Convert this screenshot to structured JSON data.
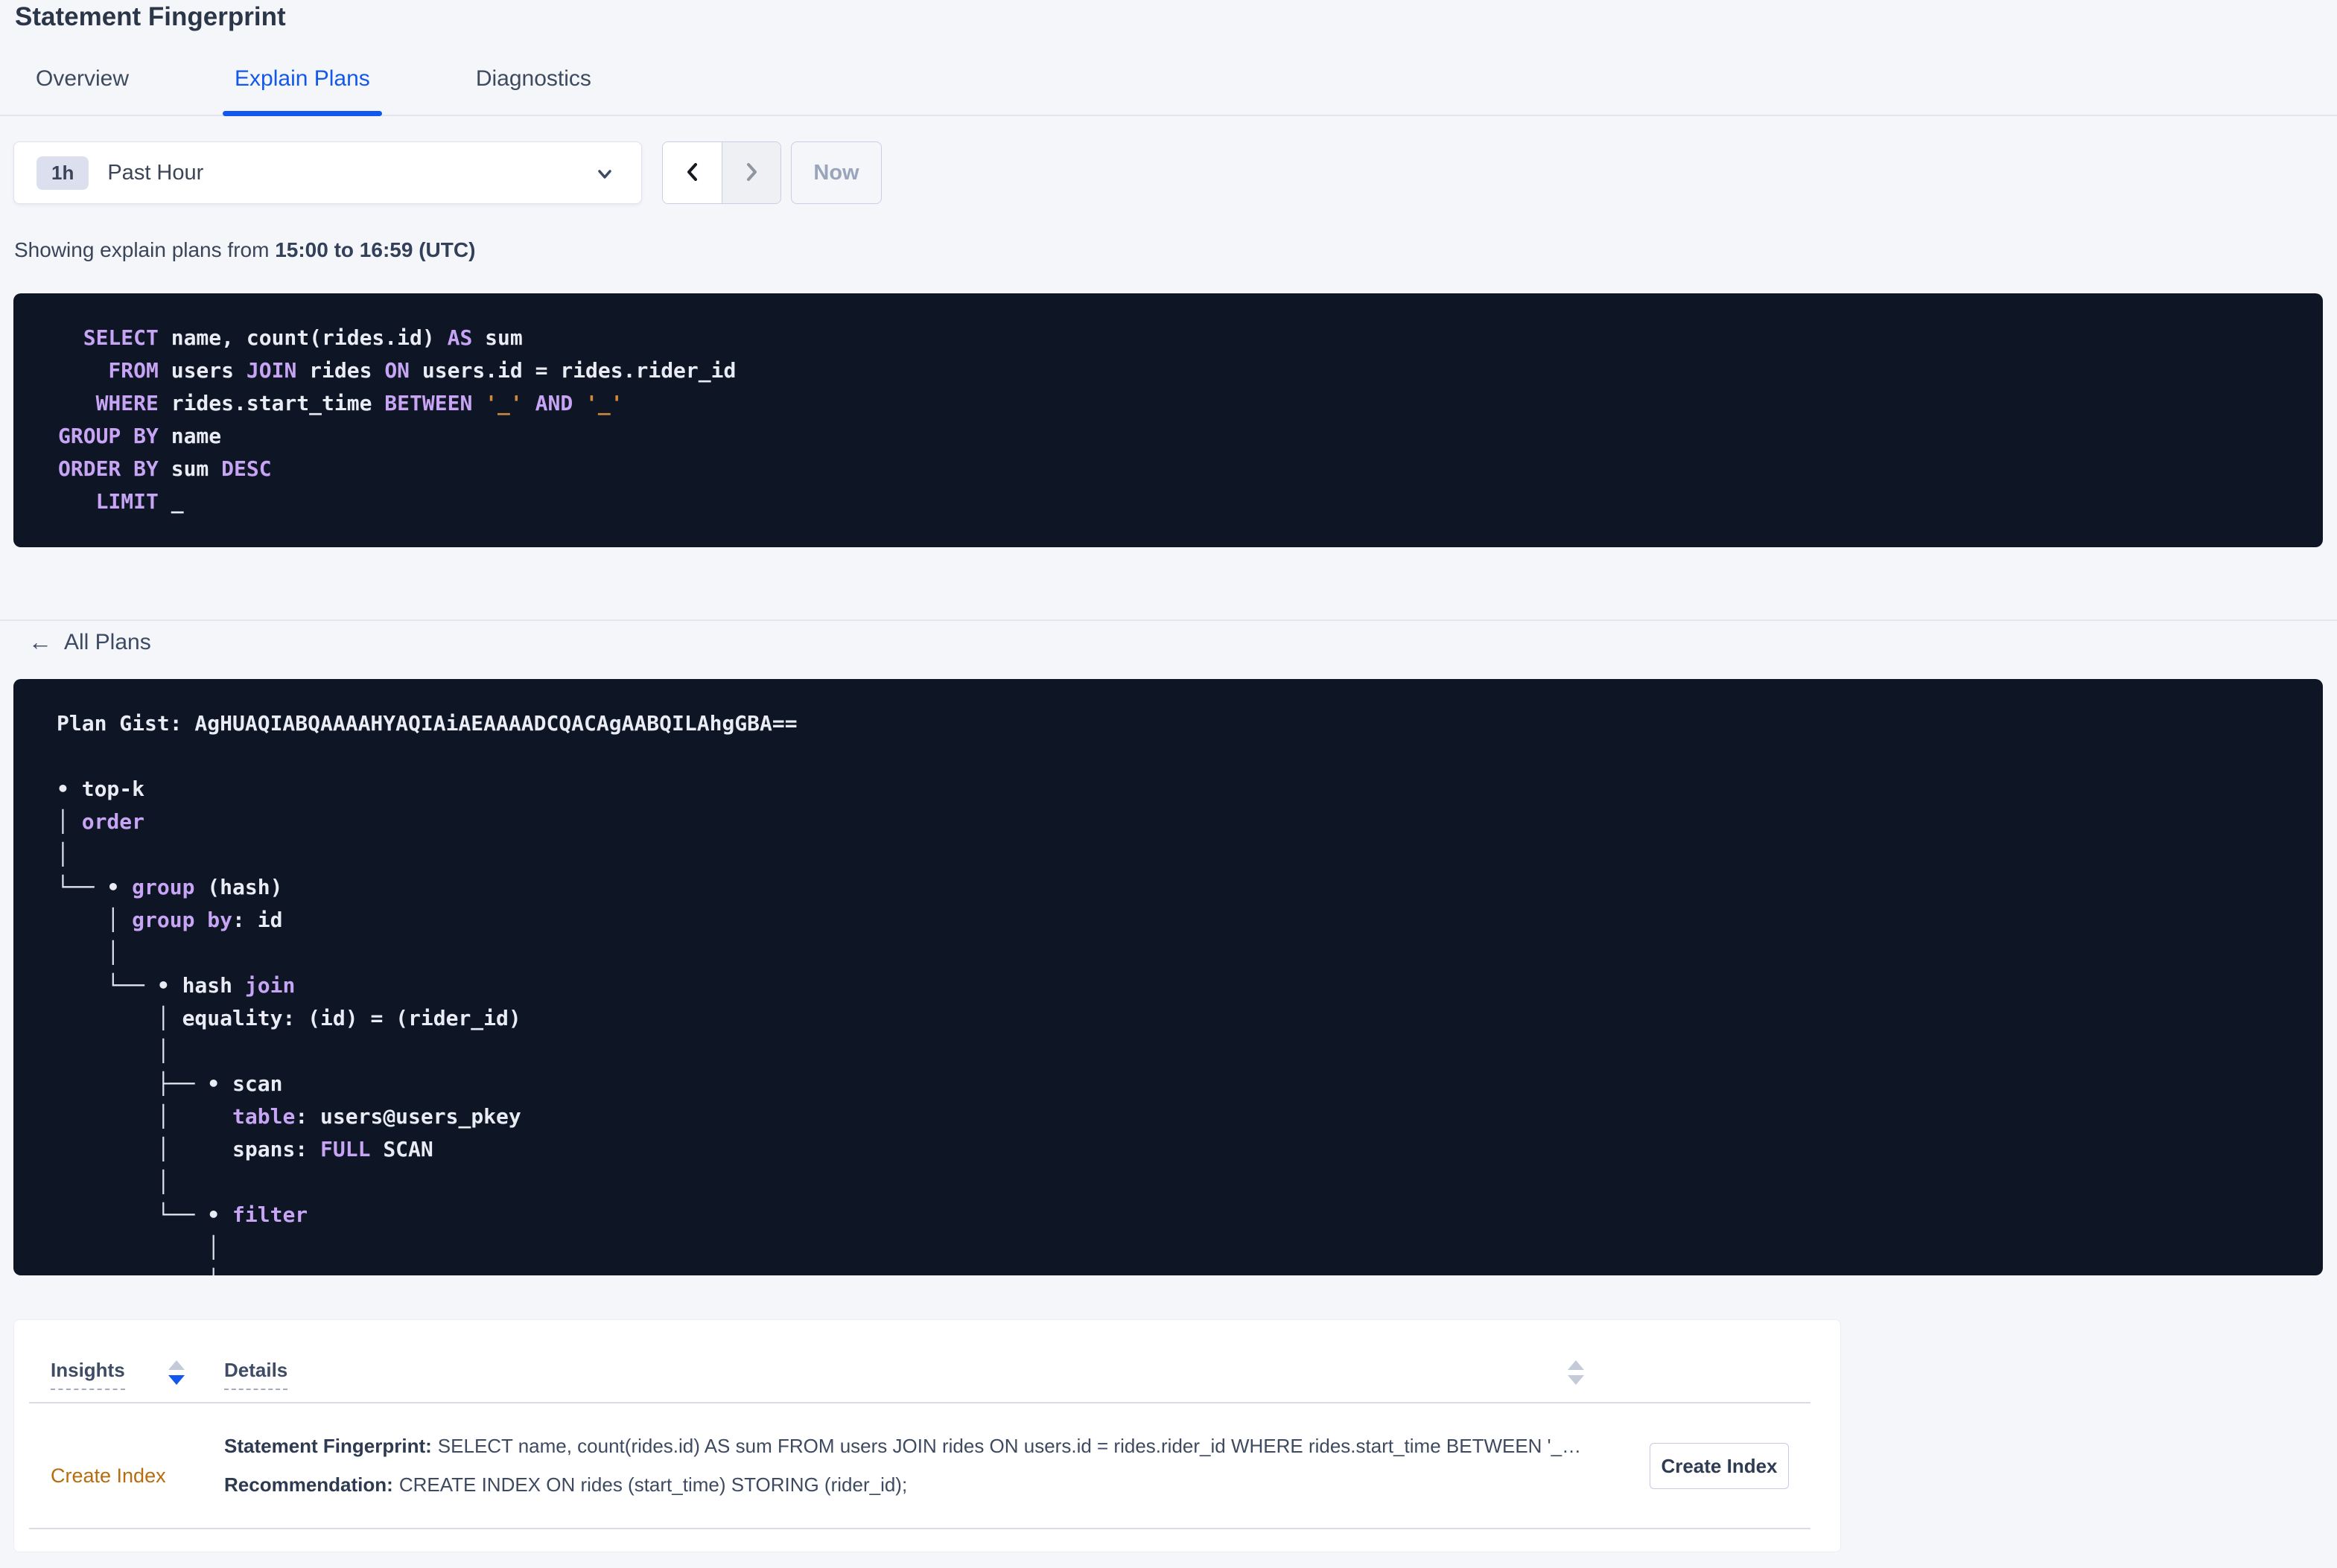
{
  "page": {
    "title": "Statement Fingerprint"
  },
  "tabs": {
    "overview": "Overview",
    "explain_plans": "Explain Plans",
    "diagnostics": "Diagnostics",
    "active_tab": "Explain Plans"
  },
  "time_picker": {
    "badge": "1h",
    "selected": "Past Hour",
    "now_label": "Now",
    "prev_enabled": true,
    "next_enabled": false
  },
  "status": {
    "prefix": "Showing explain plans from ",
    "range": "15:00 to 16:59 (UTC)"
  },
  "sql": {
    "lines": [
      [
        [
          "kw",
          "  SELECT"
        ],
        [
          "tx",
          " name, count(rides.id) "
        ],
        [
          "kw",
          "AS"
        ],
        [
          "tx",
          " sum"
        ]
      ],
      [
        [
          "kw",
          "    FROM"
        ],
        [
          "tx",
          " users "
        ],
        [
          "kw",
          "JOIN"
        ],
        [
          "tx",
          " rides "
        ],
        [
          "kw",
          "ON"
        ],
        [
          "tx",
          " users.id = rides.rider_id"
        ]
      ],
      [
        [
          "kw",
          "   WHERE"
        ],
        [
          "tx",
          " rides.start_time "
        ],
        [
          "kw",
          "BETWEEN"
        ],
        [
          "tx",
          " "
        ],
        [
          "st",
          "'_'"
        ],
        [
          "tx",
          " "
        ],
        [
          "kw",
          "AND"
        ],
        [
          "tx",
          " "
        ],
        [
          "st",
          "'_'"
        ]
      ],
      [
        [
          "kw",
          "GROUP BY"
        ],
        [
          "tx",
          " name"
        ]
      ],
      [
        [
          "kw",
          "ORDER BY"
        ],
        [
          "tx",
          " sum "
        ],
        [
          "kw",
          "DESC"
        ]
      ],
      [
        [
          "kw",
          "   LIMIT"
        ],
        [
          "tx",
          " _"
        ]
      ]
    ]
  },
  "back_link": {
    "label": "All Plans"
  },
  "plan": {
    "gist": "AgHUAQIABQAAAAHYAQIAiAEAAAADCQACAgAABQILAhgGBA==",
    "lines": [
      [
        [
          "tx",
          "Plan Gist: AgHUAQIABQAAAAHYAQIAiAEAAAADCQACAgAABQILAhgGBA=="
        ]
      ],
      [],
      [
        [
          "tx",
          "• top-k"
        ]
      ],
      [
        [
          "ln",
          "│ "
        ],
        [
          "kw",
          "order"
        ]
      ],
      [
        [
          "ln",
          "│"
        ]
      ],
      [
        [
          "ln",
          "└── "
        ],
        [
          "tx",
          "• "
        ],
        [
          "kw",
          "group"
        ],
        [
          "tx",
          " (hash)"
        ]
      ],
      [
        [
          "ln",
          "    │ "
        ],
        [
          "kw",
          "group by"
        ],
        [
          "tx",
          ": id"
        ]
      ],
      [
        [
          "ln",
          "    │"
        ]
      ],
      [
        [
          "ln",
          "    └── "
        ],
        [
          "tx",
          "• hash "
        ],
        [
          "kw",
          "join"
        ]
      ],
      [
        [
          "ln",
          "        │ "
        ],
        [
          "tx",
          "equality: (id) = (rider_id)"
        ]
      ],
      [
        [
          "ln",
          "        │"
        ]
      ],
      [
        [
          "ln",
          "        ├── "
        ],
        [
          "tx",
          "• scan"
        ]
      ],
      [
        [
          "ln",
          "        │     "
        ],
        [
          "kw",
          "table"
        ],
        [
          "tx",
          ": users@users_pkey"
        ]
      ],
      [
        [
          "ln",
          "        │     "
        ],
        [
          "tx",
          "spans: "
        ],
        [
          "kw",
          "FULL"
        ],
        [
          "tx",
          " SCAN"
        ]
      ],
      [
        [
          "ln",
          "        │"
        ]
      ],
      [
        [
          "ln",
          "        └── "
        ],
        [
          "tx",
          "• "
        ],
        [
          "kw",
          "filter"
        ]
      ],
      [
        [
          "ln",
          "            │"
        ]
      ],
      [
        [
          "ln",
          "            │"
        ]
      ]
    ]
  },
  "insights_table": {
    "columns": [
      "Insights",
      "Details"
    ],
    "sort": {
      "column": "Insights",
      "direction": "desc"
    },
    "rows": [
      {
        "insight": "Create Index",
        "fingerprint_label": "Statement Fingerprint:",
        "fingerprint": "SELECT name, count(rides.id) AS sum FROM users JOIN rides ON users.id = rides.rider_id WHERE rides.start_time BETWEEN '_…",
        "recommendation_label": "Recommendation:",
        "recommendation": "CREATE INDEX ON rides (start_time) STORING (rider_id);",
        "action": "Create Index"
      }
    ]
  },
  "icons": [
    "chevron-down-icon",
    "chevron-left-icon",
    "chevron-right-icon",
    "back-arrow-icon",
    "sort-icon"
  ],
  "colors": {
    "accent_blue": "#1258ee",
    "insight_orange": "#b76c0e",
    "code_background": "#0e1626",
    "code_keyword": "#c7a5f4",
    "code_text": "#e9ecf4",
    "code_literal": "#d0883c",
    "page_background": "#f4f6fa"
  }
}
